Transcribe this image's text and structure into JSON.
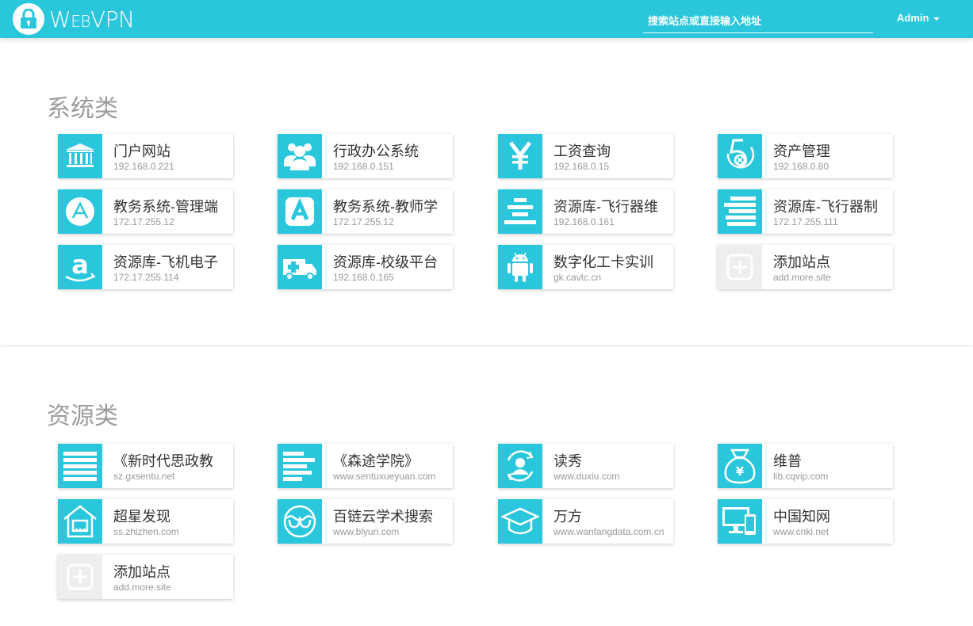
{
  "header": {
    "brand_big_w": "W",
    "brand_small_eb": "EB",
    "brand_rest": "VPN",
    "search_placeholder": "搜索站点或直接输入地址",
    "user_label": "Admin"
  },
  "sections": [
    {
      "title": "系统类",
      "cards": [
        {
          "name": "门户网站",
          "addr": "192.168.0.221",
          "icon": "bank-icon"
        },
        {
          "name": "行政办公系统",
          "addr": "192.168.0.151",
          "icon": "users-group-icon"
        },
        {
          "name": "工资查询",
          "addr": "192.168.0.15",
          "icon": "yen-icon"
        },
        {
          "name": "资产管理",
          "addr": "192.168.0.80",
          "icon": "asset-5-icon"
        },
        {
          "name": "教务系统-管理端",
          "addr": "172.17.255.12",
          "icon": "app-store-circle-icon"
        },
        {
          "name": "教务系统-教师学",
          "addr": "172.17.255.12",
          "icon": "app-store-square-icon"
        },
        {
          "name": "资源库-飞行器维",
          "addr": "192.168.0.161",
          "icon": "align-center-icon"
        },
        {
          "name": "资源库-飞行器制",
          "addr": "172.17.255.111",
          "icon": "align-bars-icon"
        },
        {
          "name": "资源库-飞机电子",
          "addr": "172.17.255.114",
          "icon": "amazon-icon"
        },
        {
          "name": "资源库-校级平台",
          "addr": "192.168.0.165",
          "icon": "ambulance-icon"
        },
        {
          "name": "数字化工卡实训",
          "addr": "gk.cavtc.cn",
          "icon": "android-icon"
        },
        {
          "name": "添加站点",
          "addr": "add.more.site",
          "icon": "add-site-icon",
          "gray": true
        }
      ]
    },
    {
      "title": "资源类",
      "cards": [
        {
          "name": "《新时代思政教",
          "addr": "sz.gxsentu.net",
          "icon": "justify-lines-icon"
        },
        {
          "name": "《森途学院》",
          "addr": "www.sentuxueyuan.com",
          "icon": "align-left-icon"
        },
        {
          "name": "读秀",
          "addr": "www.duxiu.com",
          "icon": "user-sync-icon"
        },
        {
          "name": "维普",
          "addr": "lib.cqvip.com",
          "icon": "money-bag-icon"
        },
        {
          "name": "超星发现",
          "addr": "ss.zhizhen.com",
          "icon": "house-icon"
        },
        {
          "name": "百链云学术搜索",
          "addr": "www.blyun.com",
          "icon": "glasses-icon"
        },
        {
          "name": "万方",
          "addr": "www.wanfangdata.com.cn",
          "icon": "graduation-cap-icon"
        },
        {
          "name": "中国知网",
          "addr": "www.cnki.net",
          "icon": "devices-icon"
        },
        {
          "name": "添加站点",
          "addr": "add.more.site",
          "icon": "add-site-icon",
          "gray": true
        }
      ]
    }
  ],
  "colors": {
    "accent": "#29c6dc",
    "title_gray": "#9c9c9c",
    "add_gray": "#eeeeee"
  }
}
